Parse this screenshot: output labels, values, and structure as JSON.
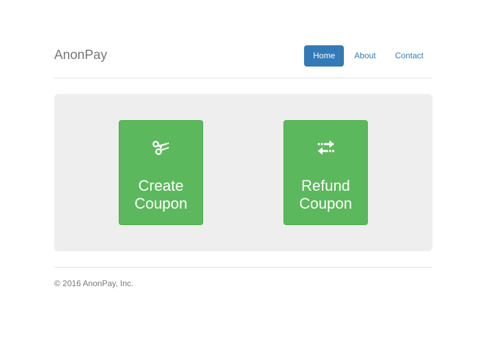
{
  "header": {
    "brand": "AnonPay",
    "nav": [
      {
        "label": "Home",
        "active": true
      },
      {
        "label": "About",
        "active": false
      },
      {
        "label": "Contact",
        "active": false
      }
    ]
  },
  "main": {
    "tiles": [
      {
        "icon": "scissors-icon",
        "line1": "Create",
        "line2": "Coupon"
      },
      {
        "icon": "transfer-arrows-icon",
        "line1": "Refund",
        "line2": "Coupon"
      }
    ]
  },
  "footer": {
    "text": "© 2016 AnonPay, Inc."
  },
  "colors": {
    "primary": "#337ab7",
    "success": "#5cb85c",
    "jumbotron": "#eeeeee"
  }
}
